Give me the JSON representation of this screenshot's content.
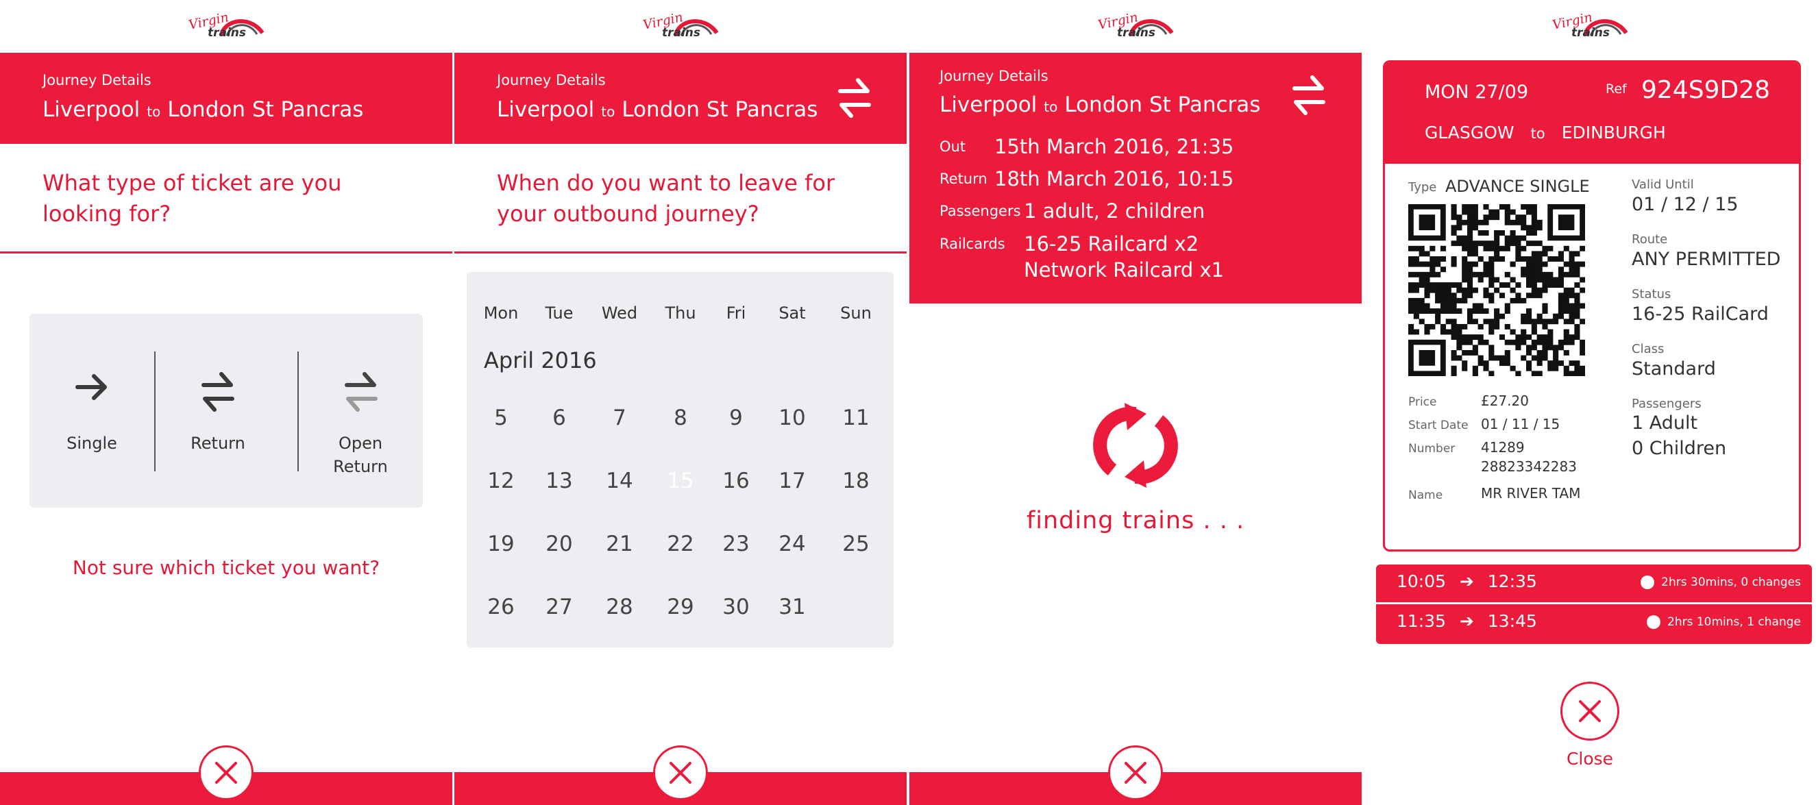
{
  "brand": {
    "logo_word1": "Virgin",
    "logo_word2": "trains",
    "accent": "#ec1a3b"
  },
  "journey": {
    "label": "Journey Details",
    "from": "Liverpool",
    "to_word": "to",
    "to": "London St Pancras"
  },
  "screen1": {
    "question": "What type of ticket are you looking for?",
    "options": [
      {
        "label": "Single",
        "icon": "arrow-right-icon"
      },
      {
        "label": "Return",
        "icon": "swap-arrows-icon"
      },
      {
        "label": "Open Return",
        "icon": "swap-arrows-faded-icon"
      }
    ],
    "help_link": "Not sure which ticket you want?"
  },
  "screen2": {
    "question": "When do you want to leave for your outbound journey?",
    "weekdays": [
      "Mon",
      "Tue",
      "Wed",
      "Thu",
      "Fri",
      "Sat",
      "Sun"
    ],
    "month": "April 2016",
    "selected_day": "15",
    "weeks": [
      [
        "5",
        "6",
        "7",
        "8",
        "9",
        "10",
        "11"
      ],
      [
        "12",
        "13",
        "14",
        "15",
        "16",
        "17",
        "18"
      ],
      [
        "19",
        "20",
        "21",
        "22",
        "23",
        "24",
        "25"
      ],
      [
        "26",
        "27",
        "28",
        "29",
        "30",
        "31"
      ]
    ]
  },
  "screen3": {
    "out_label": "Out",
    "out_value": "15th March 2016, 21:35",
    "return_label": "Return",
    "return_value": "18th March 2016, 10:15",
    "passengers_label": "Passengers",
    "passengers_value": "1 adult, 2 children",
    "railcards_label": "Railcards",
    "railcards_value1": "16-25 Railcard x2",
    "railcards_value2": "Network Railcard x1",
    "status": "finding trains . . ."
  },
  "screen4": {
    "date": "MON 27/09",
    "ref_label": "Ref",
    "ref": "924S9D28",
    "from": "GLASGOW",
    "to_word": "to",
    "to": "EDINBURGH",
    "type_label": "Type",
    "type_value": "ADVANCE SINGLE",
    "price_label": "Price",
    "price_value": "£27.20",
    "start_label": "Start Date",
    "start_value": "01 / 11 / 15",
    "number_label": "Number",
    "number_value1": "41289",
    "number_value2": "28823342283",
    "name_label": "Name",
    "name_value": "MR RIVER TAM",
    "valid_label": "Valid Until",
    "valid_value": "01 / 12 / 15",
    "route_label": "Route",
    "route_value": "ANY PERMITTED",
    "status_label": "Status",
    "status_value": "16-25 RailCard",
    "class_label": "Class",
    "class_value": "Standard",
    "pass_label": "Passengers",
    "pass_value1": "1 Adult",
    "pass_value2": "0 Children",
    "journeys": [
      {
        "depart": "10:05",
        "arrive": "12:35",
        "info": "2hrs 30mins, 0 changes"
      },
      {
        "depart": "11:35",
        "arrive": "13:45",
        "info": "2hrs 10mins, 1 change"
      }
    ],
    "close_label": "Close"
  }
}
